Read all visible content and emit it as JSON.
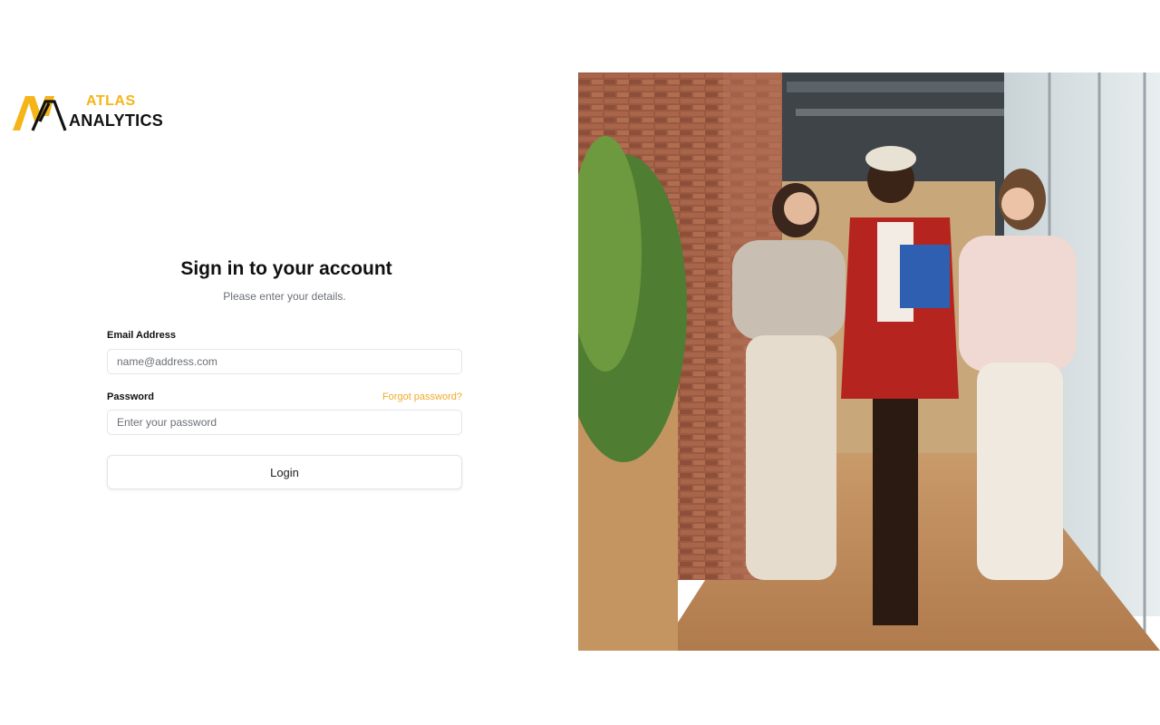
{
  "brand": {
    "line1": "ATLAS",
    "line2": "ANALYTICS",
    "accent": "#f5b417"
  },
  "form": {
    "title": "Sign in to your account",
    "subtitle": "Please enter your details.",
    "email": {
      "label": "Email Address",
      "placeholder": "name@address.com",
      "value": ""
    },
    "password": {
      "label": "Password",
      "placeholder": "Enter your password",
      "value": ""
    },
    "forgot_label": "Forgot password?",
    "login_label": "Login"
  },
  "hero_image": {
    "subject": "three-women-walking-office-corridor"
  }
}
